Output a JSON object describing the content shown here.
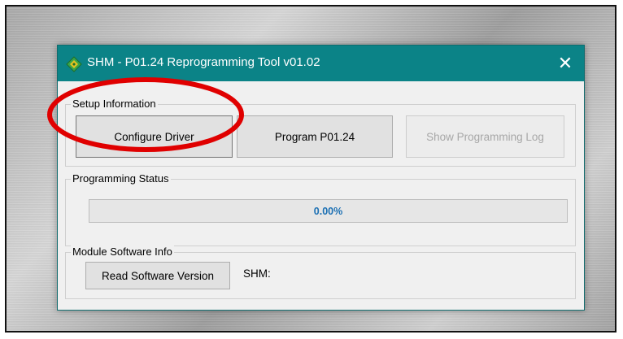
{
  "window": {
    "title": "SHM - P01.24 Reprogramming Tool v01.02",
    "close_glyph": "✕",
    "titlebar_color": "#0b8387"
  },
  "setup": {
    "label": "Setup Information",
    "buttons": [
      {
        "label": "Configure Driver",
        "enabled": true
      },
      {
        "label": "Program P01.24",
        "enabled": true
      },
      {
        "label": "Show Programming Log",
        "enabled": false
      }
    ]
  },
  "status": {
    "label": "Programming Status",
    "progress_text": "0.00%",
    "progress_fraction": 0.0
  },
  "module": {
    "label": "Module Software Info",
    "read_button": "Read Software Version",
    "shm_label": "SHM:"
  },
  "annotation": {
    "shape": "ellipse",
    "color": "#e00000",
    "highlights": "configure-driver-button"
  },
  "icons": {
    "app": "green-diamond-app-icon",
    "close": "close-icon"
  }
}
